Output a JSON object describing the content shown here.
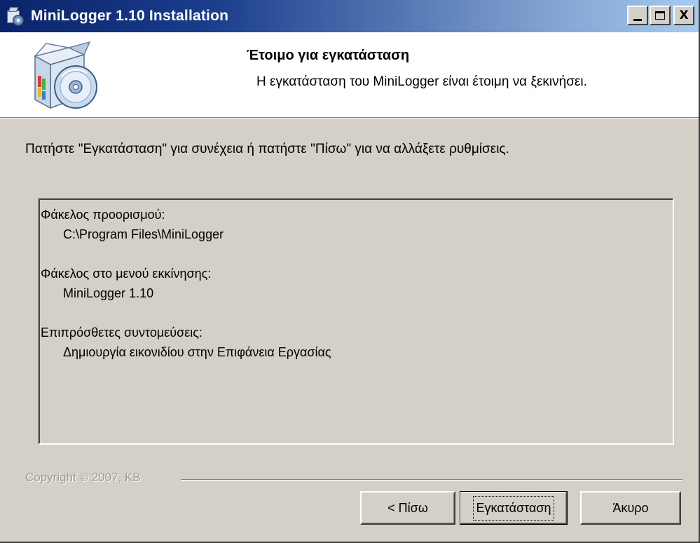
{
  "window": {
    "title": "MiniLogger 1.10 Installation",
    "titlebar_icon": "installer-icon",
    "accent_color": "#0a246a"
  },
  "titlebar_buttons": {
    "minimize": "minimize-icon",
    "maximize": "maximize-icon",
    "close_label": "X"
  },
  "header": {
    "title": "Έτοιμο για εγκατάσταση",
    "subtitle": "Η εγκατάσταση του MiniLogger είναι έτοιμη να ξεκινήσει.",
    "icon": "software-box-cd-icon"
  },
  "instruction": "Πατήστε \"Εγκατάσταση\" για συνέχεια ή πατήστε \"Πίσω\" για να αλλάξετε ρυθμίσεις.",
  "summary": {
    "destination_heading": "Φάκελος προορισμού:",
    "destination_value": "C:\\Program Files\\MiniLogger",
    "startmenu_heading": "Φάκελος στο μενού εκκίνησης:",
    "startmenu_value": "MiniLogger 1.10",
    "shortcuts_heading": "Επιπρόσθετες συντομεύσεις:",
    "shortcuts_value": "Δημιουργία εικονιδίου στην Επιφάνεια Εργασίας"
  },
  "footer": {
    "copyright": "Copyright © 2007, KB"
  },
  "buttons": {
    "back": "< Πίσω",
    "install": "Εγκατάσταση",
    "cancel": "Άκυρο"
  }
}
